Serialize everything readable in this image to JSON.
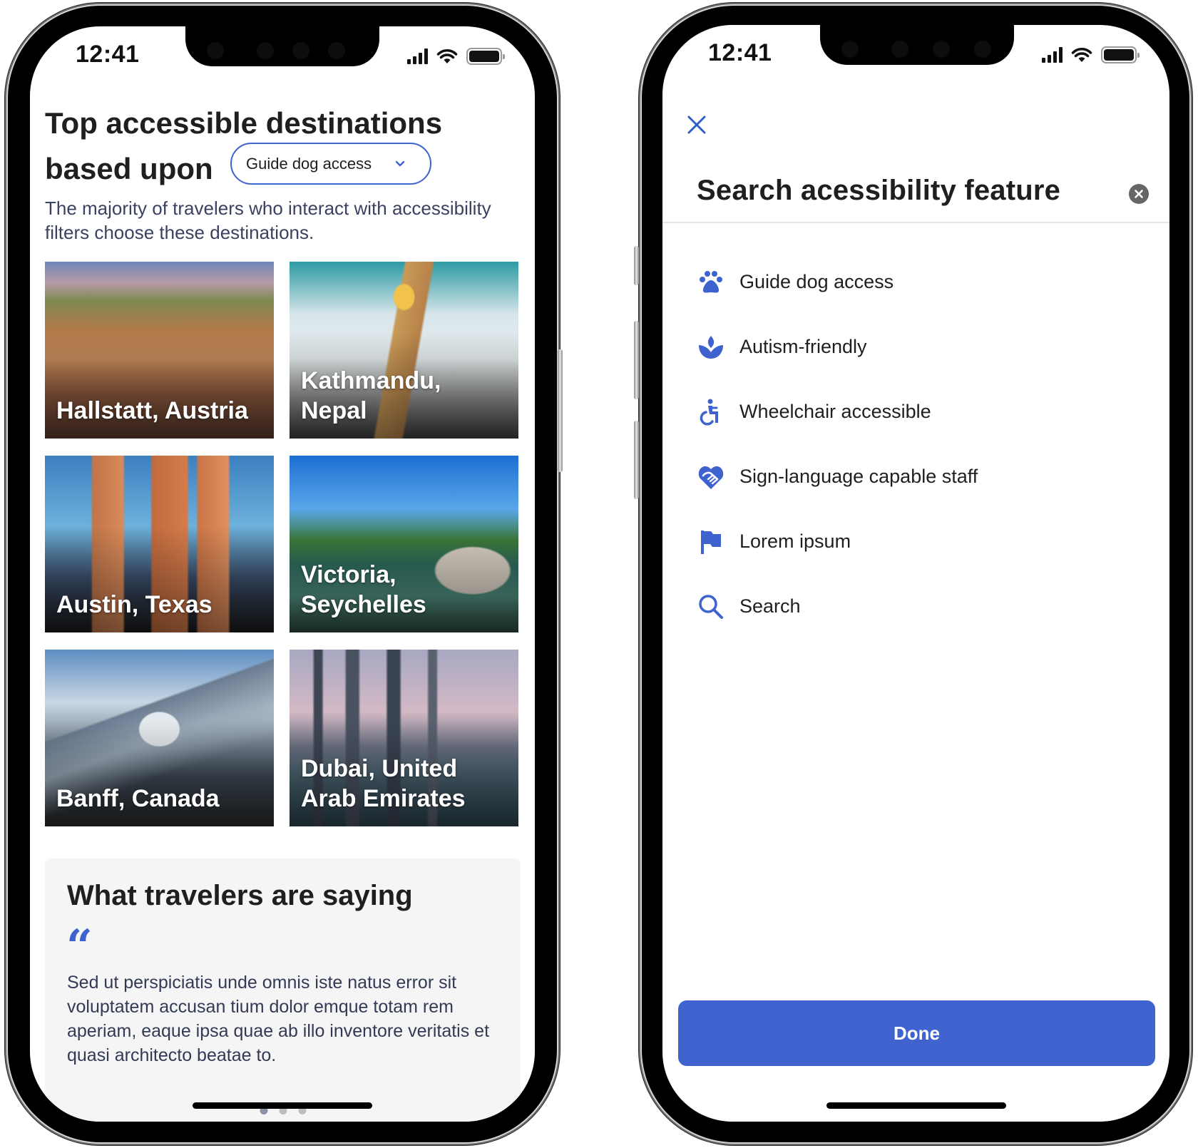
{
  "left_screen": {
    "status_bar": {
      "time": "12:41"
    },
    "title": "Top accessible destinations based upon",
    "filter_dropdown": {
      "selected": "Guide dog access"
    },
    "subtitle": "The majority of travelers who interact with accessibility filters choose these destinations.",
    "destinations": [
      {
        "name": "Hallstatt, Austria"
      },
      {
        "name": "Kathmandu, Nepal"
      },
      {
        "name": "Austin, Texas"
      },
      {
        "name": "Victoria, Seychelles"
      },
      {
        "name": "Banff, Canada"
      },
      {
        "name": "Dubai, United Arab Emirates"
      }
    ],
    "testimonials": {
      "heading": "What travelers are saying",
      "quote_icon": "quote-open-icon",
      "quote": "Sed ut perspiciatis unde omnis iste natus error sit voluptatem accusan tium dolor emque totam rem aperiam, eaque ipsa quae ab illo inventore veritatis et quasi architecto beatae to.",
      "pagination": {
        "total": 3,
        "active": 1
      }
    }
  },
  "right_screen": {
    "status_bar": {
      "time": "12:41"
    },
    "title": "Search acessibility feature",
    "features": [
      {
        "label": "Guide dog access",
        "icon": "paw-icon"
      },
      {
        "label": "Autism-friendly",
        "icon": "lotus-icon"
      },
      {
        "label": "Wheelchair accessible",
        "icon": "wheelchair-icon"
      },
      {
        "label": "Sign-language capable staff",
        "icon": "handshake-heart-icon"
      },
      {
        "label": "Lorem ipsum",
        "icon": "flag-icon"
      },
      {
        "label": "Search",
        "icon": "search-icon"
      }
    ],
    "done_label": "Done"
  },
  "colors": {
    "accent": "#4063d0",
    "icon_blue": "#3e63cf",
    "text_primary": "#1f1f1f",
    "text_secondary": "#3b4261",
    "panel_bg": "#f5f5f5"
  }
}
